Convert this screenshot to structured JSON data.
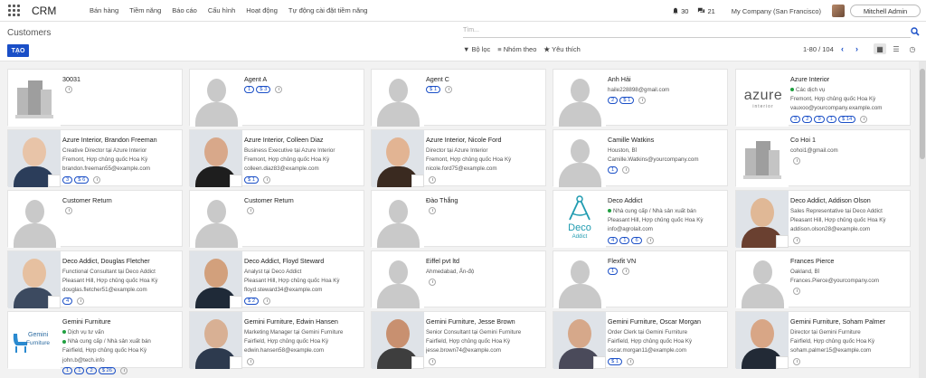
{
  "navbar": {
    "brand": "CRM",
    "menu": [
      "Bán hàng",
      "Tiềm năng",
      "Báo cáo",
      "Cấu hình",
      "Hoạt động",
      "Tự động cài đặt tiềm năng"
    ],
    "notifications": "30",
    "messages": "21",
    "company": "My Company (San Francisco)",
    "user": "Mitchell Admin"
  },
  "control": {
    "title": "Customers",
    "search_placeholder": "Tìm...",
    "new_label": "TẠO",
    "filters_label": "Bộ lọc",
    "groupby_label": "Nhóm theo",
    "favorites_label": "Yêu thích",
    "pager": "1-80 / 104"
  },
  "cards": [
    {
      "name": "30031",
      "lines": [],
      "badges": [],
      "thumb": "building"
    },
    {
      "name": "Agent A",
      "lines": [],
      "badges": [
        "1",
        "$ 3"
      ],
      "thumb": "sil"
    },
    {
      "name": "Agent C",
      "lines": [],
      "badges": [
        "$ 1"
      ],
      "thumb": "sil"
    },
    {
      "name": "Anh Hải",
      "lines": [
        "haile228898@gmail.com"
      ],
      "badges": [
        "2",
        "$ 1"
      ],
      "thumb": "sil"
    },
    {
      "name": "Azure Interior",
      "lines": [
        "• Các dịch vụ",
        "Fremont, Hợp chủng quốc Hoa Kỳ",
        "vauxoo@yourcompany.example.com"
      ],
      "badges": [
        "3",
        "2",
        "9",
        "1",
        "$ 14"
      ],
      "thumb": "azure"
    },
    {
      "name": "Azure Interior, Brandon Freeman",
      "lines": [
        "Creative Director tại Azure Interior",
        "Fremont, Hợp chủng quốc Hoa Kỳ",
        "brandon.freeman55@example.com"
      ],
      "badges": [
        "3",
        "$ 6"
      ],
      "thumb": "photo1"
    },
    {
      "name": "Azure Interior, Colleen Diaz",
      "lines": [
        "Business Executive tại Azure Interior",
        "Fremont, Hợp chủng quốc Hoa Kỳ",
        "colleen.diaz83@example.com"
      ],
      "badges": [
        "$ 1"
      ],
      "thumb": "photo2"
    },
    {
      "name": "Azure Interior, Nicole Ford",
      "lines": [
        "Director tại Azure Interior",
        "Fremont, Hợp chủng quốc Hoa Kỳ",
        "nicole.ford75@example.com"
      ],
      "badges": [],
      "thumb": "photo3"
    },
    {
      "name": "Camille Watkins",
      "lines": [
        "Houston, Bỉ",
        "Camille.Watkins@yourcompany.com"
      ],
      "badges": [
        "1"
      ],
      "thumb": "sil"
    },
    {
      "name": "Co Hoi 1",
      "lines": [
        "cohoi1@gmail.com"
      ],
      "badges": [],
      "thumb": "building"
    },
    {
      "name": "Customer Return",
      "lines": [],
      "badges": [],
      "thumb": "sil"
    },
    {
      "name": "Customer Return",
      "lines": [],
      "badges": [],
      "thumb": "sil"
    },
    {
      "name": "Đào Thắng",
      "lines": [],
      "badges": [],
      "thumb": "sil"
    },
    {
      "name": "Deco Addict",
      "lines": [
        "• Nhà cung cấp / Nhà sản xuất bán",
        "Pleasant Hill, Hợp chủng quốc Hoa Kỳ",
        "info@agrolait.com"
      ],
      "badges": [
        "4",
        "1",
        "6"
      ],
      "thumb": "deco"
    },
    {
      "name": "Deco Addict, Addison Olson",
      "lines": [
        "Sales Representative tại Deco Addict",
        "Pleasant Hill, Hợp chủng quốc Hoa Kỳ",
        "addison.olson28@example.com"
      ],
      "badges": [],
      "thumb": "photo4"
    },
    {
      "name": "Deco Addict, Douglas Fletcher",
      "lines": [
        "Functional Consultant tại Deco Addict",
        "Pleasant Hill, Hợp chủng quốc Hoa Kỳ",
        "douglas.fletcher51@example.com"
      ],
      "badges": [
        "4"
      ],
      "thumb": "photo5"
    },
    {
      "name": "Deco Addict, Floyd Steward",
      "lines": [
        "Analyst tại Deco Addict",
        "Pleasant Hill, Hợp chủng quốc Hoa Kỳ",
        "floyd.steward34@example.com"
      ],
      "badges": [
        "$ 2"
      ],
      "thumb": "photo6"
    },
    {
      "name": "Eiffel pvt ltd",
      "lines": [
        "Ahmedabad, Ấn-độ"
      ],
      "badges": [],
      "thumb": "sil"
    },
    {
      "name": "Flexfit VN",
      "lines": [],
      "badges": [
        "1"
      ],
      "thumb": "sil"
    },
    {
      "name": "Frances Pierce",
      "lines": [
        "Oakland, Bỉ",
        "Frances.Pierce@yourcompany.com"
      ],
      "badges": [],
      "thumb": "sil"
    },
    {
      "name": "Gemini Furniture",
      "lines": [
        "• Dịch vụ tư vấn",
        "• Nhà cung cấp / Nhà sản xuất bán",
        "Fairfield, Hợp chủng quốc Hoa Kỳ",
        "john.b@tech.info"
      ],
      "badges": [
        "1",
        "1",
        "2",
        "$ 26"
      ],
      "thumb": "gemini"
    },
    {
      "name": "Gemini Furniture, Edwin Hansen",
      "lines": [
        "Marketing Manager tại Gemini Furniture",
        "Fairfield, Hợp chủng quốc Hoa Kỳ",
        "edwin.hansen58@example.com"
      ],
      "badges": [],
      "thumb": "photo7"
    },
    {
      "name": "Gemini Furniture, Jesse Brown",
      "lines": [
        "Senior Consultant tại Gemini Furniture",
        "Fairfield, Hợp chủng quốc Hoa Kỳ",
        "jesse.brown74@example.com"
      ],
      "badges": [],
      "thumb": "photo8"
    },
    {
      "name": "Gemini Furniture, Oscar Morgan",
      "lines": [
        "Order Clerk tại Gemini Furniture",
        "Fairfield, Hợp chủng quốc Hoa Kỳ",
        "oscar.morgan11@example.com"
      ],
      "badges": [
        "$ 1"
      ],
      "thumb": "photo9"
    },
    {
      "name": "Gemini Furniture, Soham Palmer",
      "lines": [
        "Director tại Gemini Furniture",
        "Fairfield, Hợp chủng quốc Hoa Kỳ",
        "soham.palmer15@example.com"
      ],
      "badges": [],
      "thumb": "photo10"
    }
  ],
  "logos": {
    "azure_word": "azure",
    "azure_sub": "interior",
    "deco_word1": "Deco",
    "deco_word2": "Addict",
    "gemini_word1": "Gemini",
    "gemini_word2": "Furniture"
  },
  "colors": {
    "primary": "#1a4fc7",
    "placeholder": "#c9c9c9",
    "tag_green": "#20a040"
  }
}
